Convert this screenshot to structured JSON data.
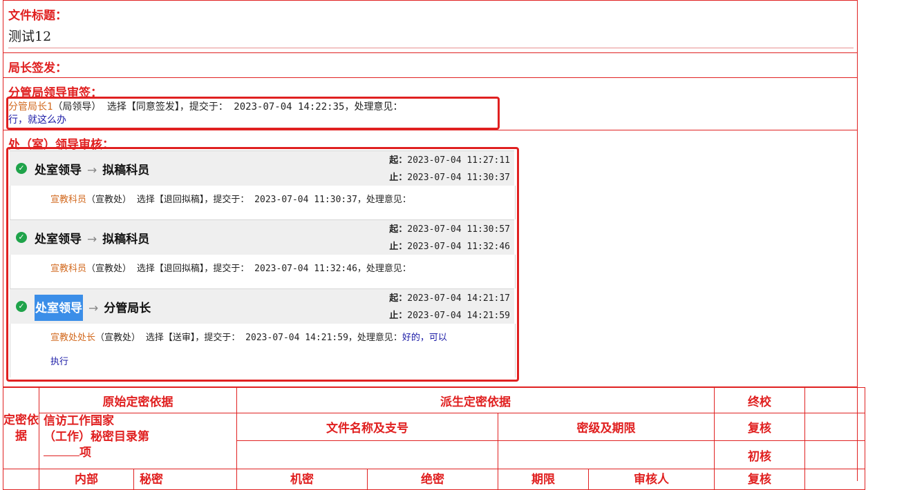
{
  "doc_title": {
    "label": "文件标题：",
    "value": "测试12"
  },
  "director_sign": {
    "label": "局长签发："
  },
  "deputy_review": {
    "label": "分管局领导审签：",
    "entry": {
      "person": "分管局长1",
      "dept": "（局领导）",
      "action": " 选择【同意签发】，提交于： 2023-07-04 14:22:35，处理意见：",
      "opinion": "行，就这么办"
    }
  },
  "office_review": {
    "label": "处（室）领导审核：",
    "start_label": "起：",
    "end_label": "止：",
    "steps": [
      {
        "from": "处室领导",
        "to": "拟稿科员",
        "start": "2023-07-04 11:27:11",
        "end": "2023-07-04 11:30:37",
        "person": "宣教科员",
        "dept": "（宣教处）",
        "action": " 选择【退回拟稿】，提交于： 2023-07-04 11:30:37，处理意见：",
        "opinion": ""
      },
      {
        "from": "处室领导",
        "to": "拟稿科员",
        "start": "2023-07-04 11:30:57",
        "end": "2023-07-04 11:32:46",
        "person": "宣教科员",
        "dept": "（宣教处）",
        "action": " 选择【退回拟稿】，提交于： 2023-07-04 11:32:46，处理意见：",
        "opinion": ""
      },
      {
        "from": "处室领导",
        "to": "分管局长",
        "start": "2023-07-04 14:21:17",
        "end": "2023-07-04 14:21:59",
        "person": "宣教处处长",
        "dept": "（宣教处）",
        "action": " 选择【送审】，提交于： 2023-07-04 14:21:59，处理意见：",
        "opinion": "好的，可以",
        "opinion_cont": "执行"
      }
    ]
  },
  "secret_table": {
    "basis_label": "定密依据",
    "original_basis": "原始定密依据",
    "derived_basis": "派生定密依据",
    "final_check": "终校",
    "catalog_line1": "信访工作国家",
    "catalog_line2": "（工作）秘密目录第",
    "catalog_line3": "项",
    "file_name_no": "文件名称及支号",
    "level_term": "密级及期限",
    "recheck": "复核",
    "first_check": "初核",
    "row4": [
      "内部",
      "秘密",
      "机密",
      "绝密",
      "期限",
      "审核人",
      "复核"
    ]
  }
}
